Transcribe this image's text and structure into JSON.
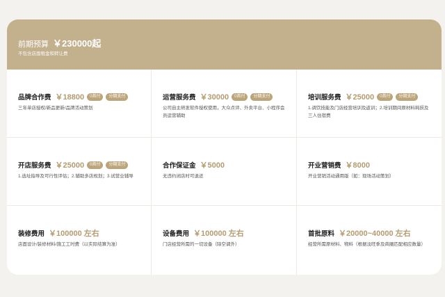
{
  "header": {
    "title": "前期预算",
    "price": "￥230000起",
    "subtitle": "不包含店面租金和转让费"
  },
  "items": [
    {
      "name": "品牌合作费",
      "price": "￥18800",
      "badges": [
        "0首付",
        "分期支付"
      ],
      "desc": "三年单店授权/新品更新/品牌活动策划"
    },
    {
      "name": "运营服务费",
      "price": "￥30000",
      "badges": [
        "0首付",
        "分期支付"
      ],
      "desc": "公司自主研发软件授权使用，大众点评、外卖平台、小程序会员运营辅助"
    },
    {
      "name": "培训服务费",
      "price": "￥25000",
      "badges": [
        "0首付",
        "分期支付"
      ],
      "desc": "1.调饮技能及门店经营培训及返训；2.培训期间原材料耗损及三人住宿费"
    },
    {
      "name": "开店服务费",
      "price": "￥25000",
      "badges": [
        "0首付",
        "分期支付"
      ],
      "desc": "1.选址指导及可行性评估；2.辅助多店规划；3.试营业辅导"
    },
    {
      "name": "合作保证金",
      "price": "￥5000",
      "badges": [],
      "desc": "无违约闭店时可退还"
    },
    {
      "name": "开业营销费",
      "price": "￥8000",
      "badges": [],
      "desc": "开业营销活动通用版（如：现场活动策划）"
    },
    {
      "name": "装修费用",
      "price": "￥100000 左右",
      "badges": [],
      "desc": "店面设计/装修材料/施工工时费（以实际结算为准）"
    },
    {
      "name": "设备费用",
      "price": "￥100000 左右",
      "badges": [],
      "desc": "门店经营所需的一切设备（除空调外）"
    },
    {
      "name": "首批原料",
      "price": "￥20000~40000 左右",
      "badges": [],
      "desc": "经营所需原材料、物料（根据淡旺季及商圈匹配相应数量）"
    }
  ]
}
